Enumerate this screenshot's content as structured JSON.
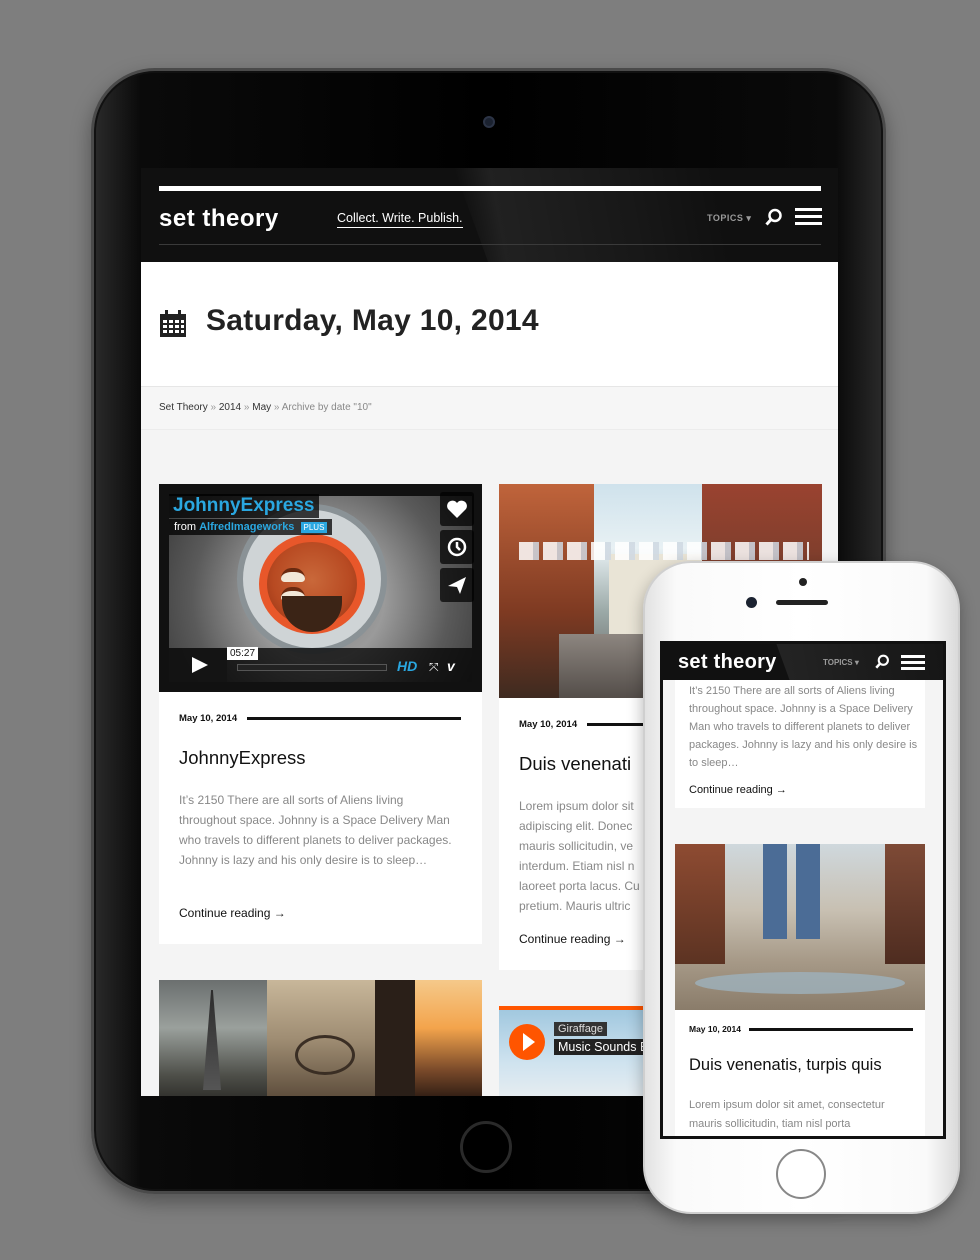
{
  "site": {
    "logo": "set theory",
    "tagline": "Collect. Write. Publish.",
    "topics_label": "TOPICS ▾"
  },
  "archive": {
    "title": "Saturday, May 10, 2014",
    "breadcrumb": {
      "home": "Set Theory",
      "sep": "»",
      "year": "2014",
      "month": "May",
      "current": "Archive by date \"10\""
    }
  },
  "posts": [
    {
      "date": "May 10, 2014",
      "title": "JohnnyExpress",
      "excerpt": "It’s 2150 There are all sorts of Aliens living throughout space. Johnny is a Space Delivery Man who travels to different planets to deliver packages. Johnny is lazy and his only desire is to sleep…",
      "more": "Continue reading →",
      "video": {
        "title": "JohnnyExpress",
        "from_prefix": "from",
        "from_name": "AlfredImageworks",
        "badge": "PLUS",
        "time": "05:27",
        "hd": "HD",
        "brand": "v"
      }
    },
    {
      "date": "May 10, 2014",
      "title": "Duis venenati",
      "excerpt": "Lorem ipsum dolor sit adipiscing elit. Donec mauris sollicitudin, ve interdum. Etiam nisl n laoreet porta lacus. Cu pretium. Mauris ultric",
      "more": "Continue reading →"
    }
  ],
  "music": {
    "artist": "Giraffage",
    "track": "Music Sounds B"
  },
  "phone": {
    "excerpt": "It’s 2150 There are all sorts of Aliens living throughout space. Johnny is a Space Delivery Man who travels to different planets to deliver packages. Johnny is lazy and his only desire is to sleep…",
    "more": "Continue reading →",
    "post2": {
      "date": "May 10, 2014",
      "title": "Duis venenatis, turpis quis",
      "excerpt": "Lorem ipsum dolor sit amet, consectetur mauris sollicitudin, tiam nisl porta"
    }
  }
}
